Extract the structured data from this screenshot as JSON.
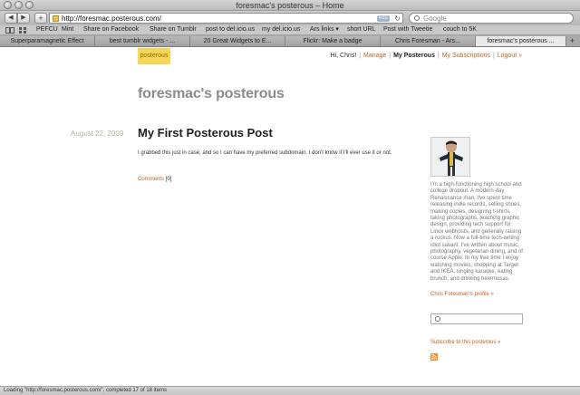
{
  "window": {
    "title": "foresmac's posterous – Home"
  },
  "toolbar": {
    "url": "http://foresmac.posterous.com/",
    "rss_badge": "RSS",
    "search_placeholder": "Google"
  },
  "bookmarks": [
    "PEFCU",
    "Mint",
    "Share on Facebook",
    "Share on Tumblr",
    "post to del.icio.us",
    "my del.icio.us",
    "Ars links ▾",
    "short URL",
    "Post with Tweetie",
    "couch to 5K"
  ],
  "tabs": [
    {
      "label": "Superparamagnetic Effect",
      "active": false
    },
    {
      "label": "best tumblr widgets - ...",
      "active": false
    },
    {
      "label": "20 Great Widgets to E...",
      "active": false
    },
    {
      "label": "Flickr: Make a badge",
      "active": false
    },
    {
      "label": "Chris Foresman - Ars...",
      "active": false
    },
    {
      "label": "foresmac's posterous ...",
      "active": true
    }
  ],
  "header": {
    "logo": "posterous",
    "greeting": "Hi, Chris!",
    "manage": "Manage",
    "my_posterous": "My Posterous",
    "my_subscriptions": "My Subscriptions",
    "logout": "Logout »"
  },
  "site": {
    "title": "foresmac's posterous"
  },
  "post": {
    "date": "August 22, 2009",
    "title": "My First Posterous Post",
    "body": "I grabbed this just in case, and so I can have my preferred subdomain. I don't know if I'll ever use it or not.",
    "comments_label": "Comments",
    "comments_count": "[0]"
  },
  "sidebar": {
    "bio": "I'm a high-functioning high school and college dropout. A modern-day Renaissance man, I've spent time releasing indie records, selling shoes, making copies, designing t-shirts, taking photographs, teaching graphic design, providing tech support for Linux webhosts, and generally raising a ruckus. Now a full-time tech-writing idiot savant, I've written about music, photography, vegetarian dining, and of course Apple. In my free time I enjoy watching movies, shopping at Target and IKEA, singing karaoke, eating brunch, and drinking beermosas.",
    "profile_link": "Chris Foresman's profile »",
    "subscribe": "Subscribe to this posterous »"
  },
  "status": {
    "text": "Loading \"http://foresmac.posterous.com/\", completed 17 of 18 items"
  }
}
